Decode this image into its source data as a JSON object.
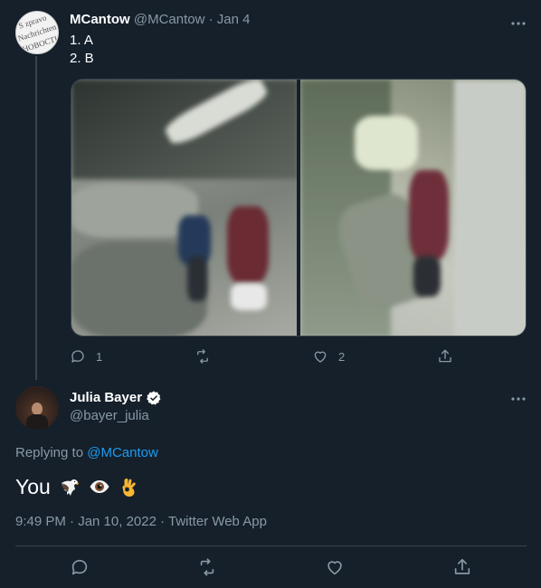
{
  "tweet1": {
    "display_name": "MCantow",
    "handle": "@MCantow",
    "separator": "·",
    "date": "Jan 4",
    "lines": [
      "1. A",
      "2. B"
    ],
    "avatar_text": [
      "S zpravo",
      "Nachrichten",
      "НОВОСТИ"
    ],
    "replies": "1",
    "likes": "2",
    "more_icon": "more-horizontal-icon"
  },
  "tweet2": {
    "display_name": "Julia Bayer",
    "handle": "@bayer_julia",
    "verified": true,
    "replying_prefix": "Replying to",
    "replying_to": "@MCantow",
    "text": "You",
    "emojis": [
      "eagle-emoji",
      "eye-emoji",
      "ok-hand-emoji"
    ],
    "timestamp": "9:49 PM · Jan 10, 2022 · Twitter Web App"
  },
  "colors": {
    "background": "#15202b",
    "muted": "#8899a6",
    "link": "#1d9bf0",
    "divider": "#38444d"
  }
}
